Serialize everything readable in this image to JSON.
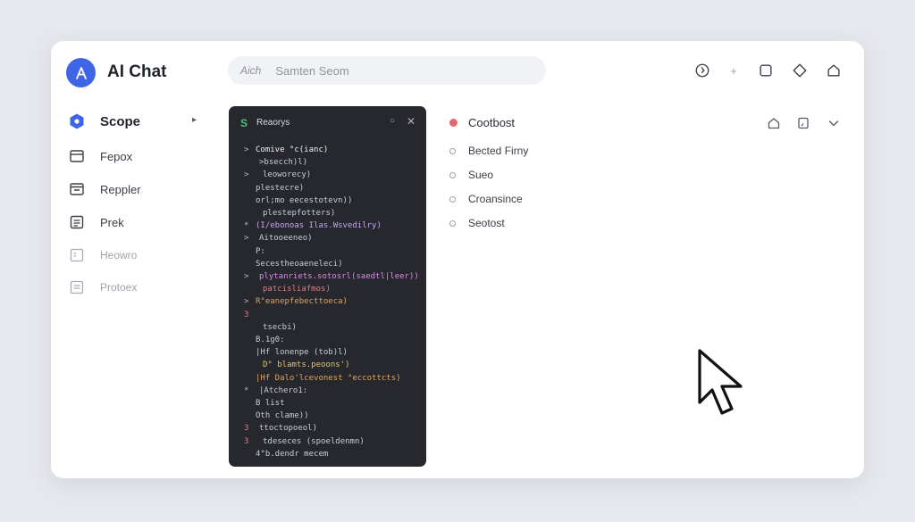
{
  "app": {
    "title": "AI Chat",
    "logo_letter": "A",
    "accent": "#3f64e6"
  },
  "search": {
    "prefix": "Aich",
    "placeholder": "Samten Seom"
  },
  "header_icons": [
    "history-icon",
    "add-icon",
    "window-icon",
    "tag-icon",
    "home-icon"
  ],
  "sidebar": {
    "items": [
      {
        "label": "Scope",
        "icon": "hexagon-icon",
        "active": true
      },
      {
        "label": "Fepox",
        "icon": "folder-icon"
      },
      {
        "label": "Reppler",
        "icon": "archive-icon"
      },
      {
        "label": "Prek",
        "icon": "document-icon"
      },
      {
        "label": "Heowro",
        "icon": "doc-icon"
      },
      {
        "label": "Protoex",
        "icon": "doc-icon"
      }
    ]
  },
  "code_panel": {
    "title": "Reaorys",
    "lines": [
      {
        "pfx": ">",
        "text": "Comive °c(ianc)",
        "color": "#f2f2f4"
      },
      {
        "pfx": "",
        "text": ">bsecch)l)",
        "color": "#c9cdd4"
      },
      {
        "pfx": ">",
        "text": "leoworecy)",
        "color": "#c9cdd4"
      },
      {
        "pfx": "",
        "text": "plestecre)",
        "color": "#c9cdd4"
      },
      {
        "pfx": "",
        "text": "orl;mo eecestotevn))",
        "color": "#c9cdd4"
      },
      {
        "pfx": "",
        "text": "plestepfotters)",
        "color": "#c9cdd4"
      },
      {
        "pfx": "*",
        "text": "(I/ebonoas Ilas.Wsvedilry)",
        "color": "#c7a6f0"
      },
      {
        "pfx": ">",
        "text": "Aitooeeneo)",
        "color": "#c9cdd4"
      },
      {
        "pfx": "",
        "text": "P:",
        "color": "#c9cdd4"
      },
      {
        "pfx": "",
        "text": "Secestheoaeneleci)",
        "color": "#c9cdd4"
      },
      {
        "pfx": ">",
        "text": "plytanriets.sotosrl(saedtl|leer))",
        "color": "#d98be6"
      },
      {
        "pfx": "",
        "text": "patcisliafmos)",
        "color": "#e07c85"
      },
      {
        "pfx": ">",
        "text": "R°eanepfebecttoeca)",
        "color": "#d6a46a"
      },
      {
        "pfx": "3",
        "text": "",
        "color": "#e07c85"
      },
      {
        "pfx": "",
        "text": "tsecbi)",
        "color": "#c9cdd4"
      },
      {
        "pfx": "",
        "text": "B.1g0:",
        "color": "#c9cdd4"
      },
      {
        "pfx": "",
        "text": "|Hf lonenpe (tob)l)",
        "color": "#c9cdd4"
      },
      {
        "pfx": "",
        "text": "D° blamts.peoons')",
        "color": "#e0c66e"
      },
      {
        "pfx": "",
        "text": "|Hf Dalo'lcevonest °eccottcts)",
        "color": "#e3a45c"
      },
      {
        "pfx": "*",
        "text": "|Atchero1:",
        "color": "#c9cdd4"
      },
      {
        "pfx": "",
        "text": "B list",
        "color": "#c9cdd4"
      },
      {
        "pfx": "",
        "text": "Oth clame))",
        "color": "#c9cdd4"
      },
      {
        "pfx": "3",
        "text": "ttoctopoeol)",
        "color": "#c9cdd4"
      },
      {
        "pfx": "3",
        "text": "tdeseces (spoeldenmn)",
        "color": "#c9cdd4"
      },
      {
        "pfx": "",
        "text": "4°b.dendr mecem",
        "color": "#c9cdd4"
      }
    ]
  },
  "right_panel": {
    "title": "Cootbost",
    "title_dot_color": "#e26a6f",
    "items": [
      "Bected Firny",
      "Sueo",
      "Croansince",
      "Seotost"
    ],
    "icons": [
      "home-icon",
      "bookmark-icon",
      "chevron-down-icon"
    ]
  }
}
